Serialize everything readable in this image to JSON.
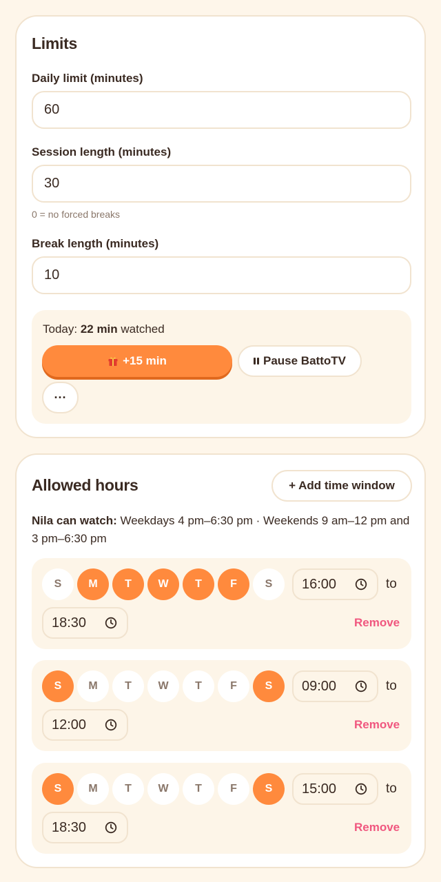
{
  "limits": {
    "title": "Limits",
    "daily_label": "Daily limit (minutes)",
    "daily_value": "60",
    "session_label": "Session length (minutes)",
    "session_value": "30",
    "session_hint": "0 = no forced breaks",
    "break_label": "Break length (minutes)",
    "break_value": "10",
    "today_prefix": "Today: ",
    "today_amount": "22 min",
    "today_suffix": " watched",
    "extra_button": "+15 min",
    "pause_button": "Pause BattoTV",
    "more_button": "···"
  },
  "hours": {
    "title": "Allowed hours",
    "add_button": "+ Add time window",
    "summary_name": "Nila can watch:",
    "summary_text": " Weekdays 4 pm–6:30 pm · Weekends 9 am–12 pm and 3 pm–6:30 pm",
    "day_letters": [
      "S",
      "M",
      "T",
      "W",
      "T",
      "F",
      "S"
    ],
    "to_label": "to",
    "remove_label": "Remove",
    "windows": [
      {
        "days_active": [
          false,
          true,
          true,
          true,
          true,
          true,
          false
        ],
        "start": "16:00",
        "end": "18:30"
      },
      {
        "days_active": [
          true,
          false,
          false,
          false,
          false,
          false,
          true
        ],
        "start": "09:00",
        "end": "12:00"
      },
      {
        "days_active": [
          true,
          false,
          false,
          false,
          false,
          false,
          true
        ],
        "start": "15:00",
        "end": "18:30"
      }
    ]
  },
  "colors": {
    "accent": "#ff8a3d",
    "page_bg": "#fef6ea",
    "card_border": "#f1e3cf",
    "remove": "#f0577f"
  },
  "icons": {
    "extra_button_icon": "gift-icon",
    "pause_button_icon": "pause-icon",
    "time_icon": "clock-icon"
  }
}
